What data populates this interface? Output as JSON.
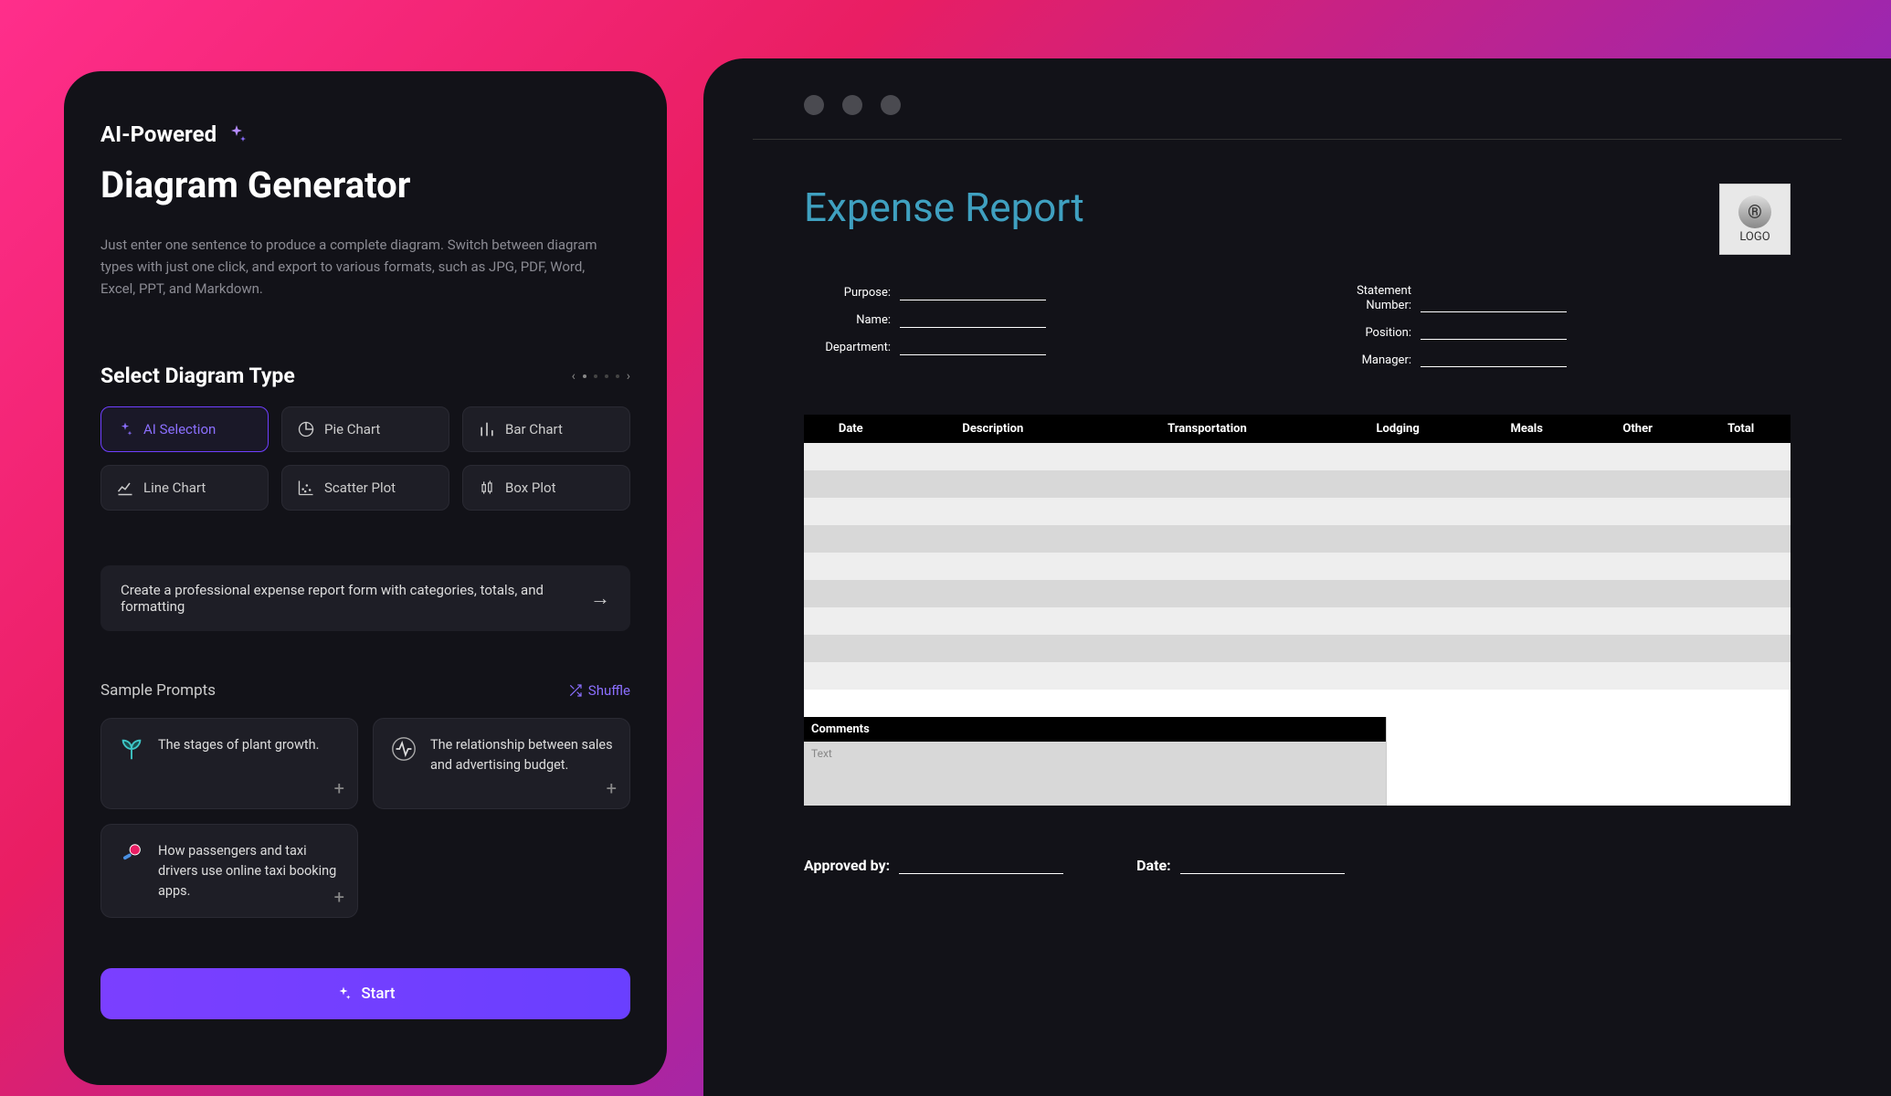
{
  "left": {
    "badge": "AI-Powered",
    "title": "Diagram Generator",
    "description": "Just enter one sentence to produce a complete diagram. Switch between diagram types with just one click, and export to various formats, such as JPG, PDF, Word, Excel, PPT, and Markdown.",
    "select_label": "Select Diagram Type",
    "types": {
      "ai": "AI Selection",
      "pie": "Pie Chart",
      "bar": "Bar Chart",
      "line": "Line Chart",
      "scatter": "Scatter Plot",
      "box": "Box Plot"
    },
    "prompt": "Create a professional expense report form with categories, totals, and formatting",
    "sample_label": "Sample Prompts",
    "shuffle": "Shuffle",
    "samples": {
      "s1": "The stages of plant growth.",
      "s2": "The relationship between sales and advertising budget.",
      "s3": "How passengers and taxi drivers use online taxi booking apps."
    },
    "start": "Start"
  },
  "right": {
    "title": "Expense Report",
    "logo_text": "LOGO",
    "fields": {
      "purpose": "Purpose:",
      "name": "Name:",
      "department": "Department:",
      "statement": "Statement Number:",
      "position": "Position:",
      "manager": "Manager:"
    },
    "columns": {
      "date": "Date",
      "description": "Description",
      "transportation": "Transportation",
      "lodging": "Lodging",
      "meals": "Meals",
      "other": "Other",
      "total": "Total"
    },
    "comments_label": "Comments",
    "comments_placeholder": "Text",
    "approved": "Approved by:",
    "date_label": "Date:"
  }
}
